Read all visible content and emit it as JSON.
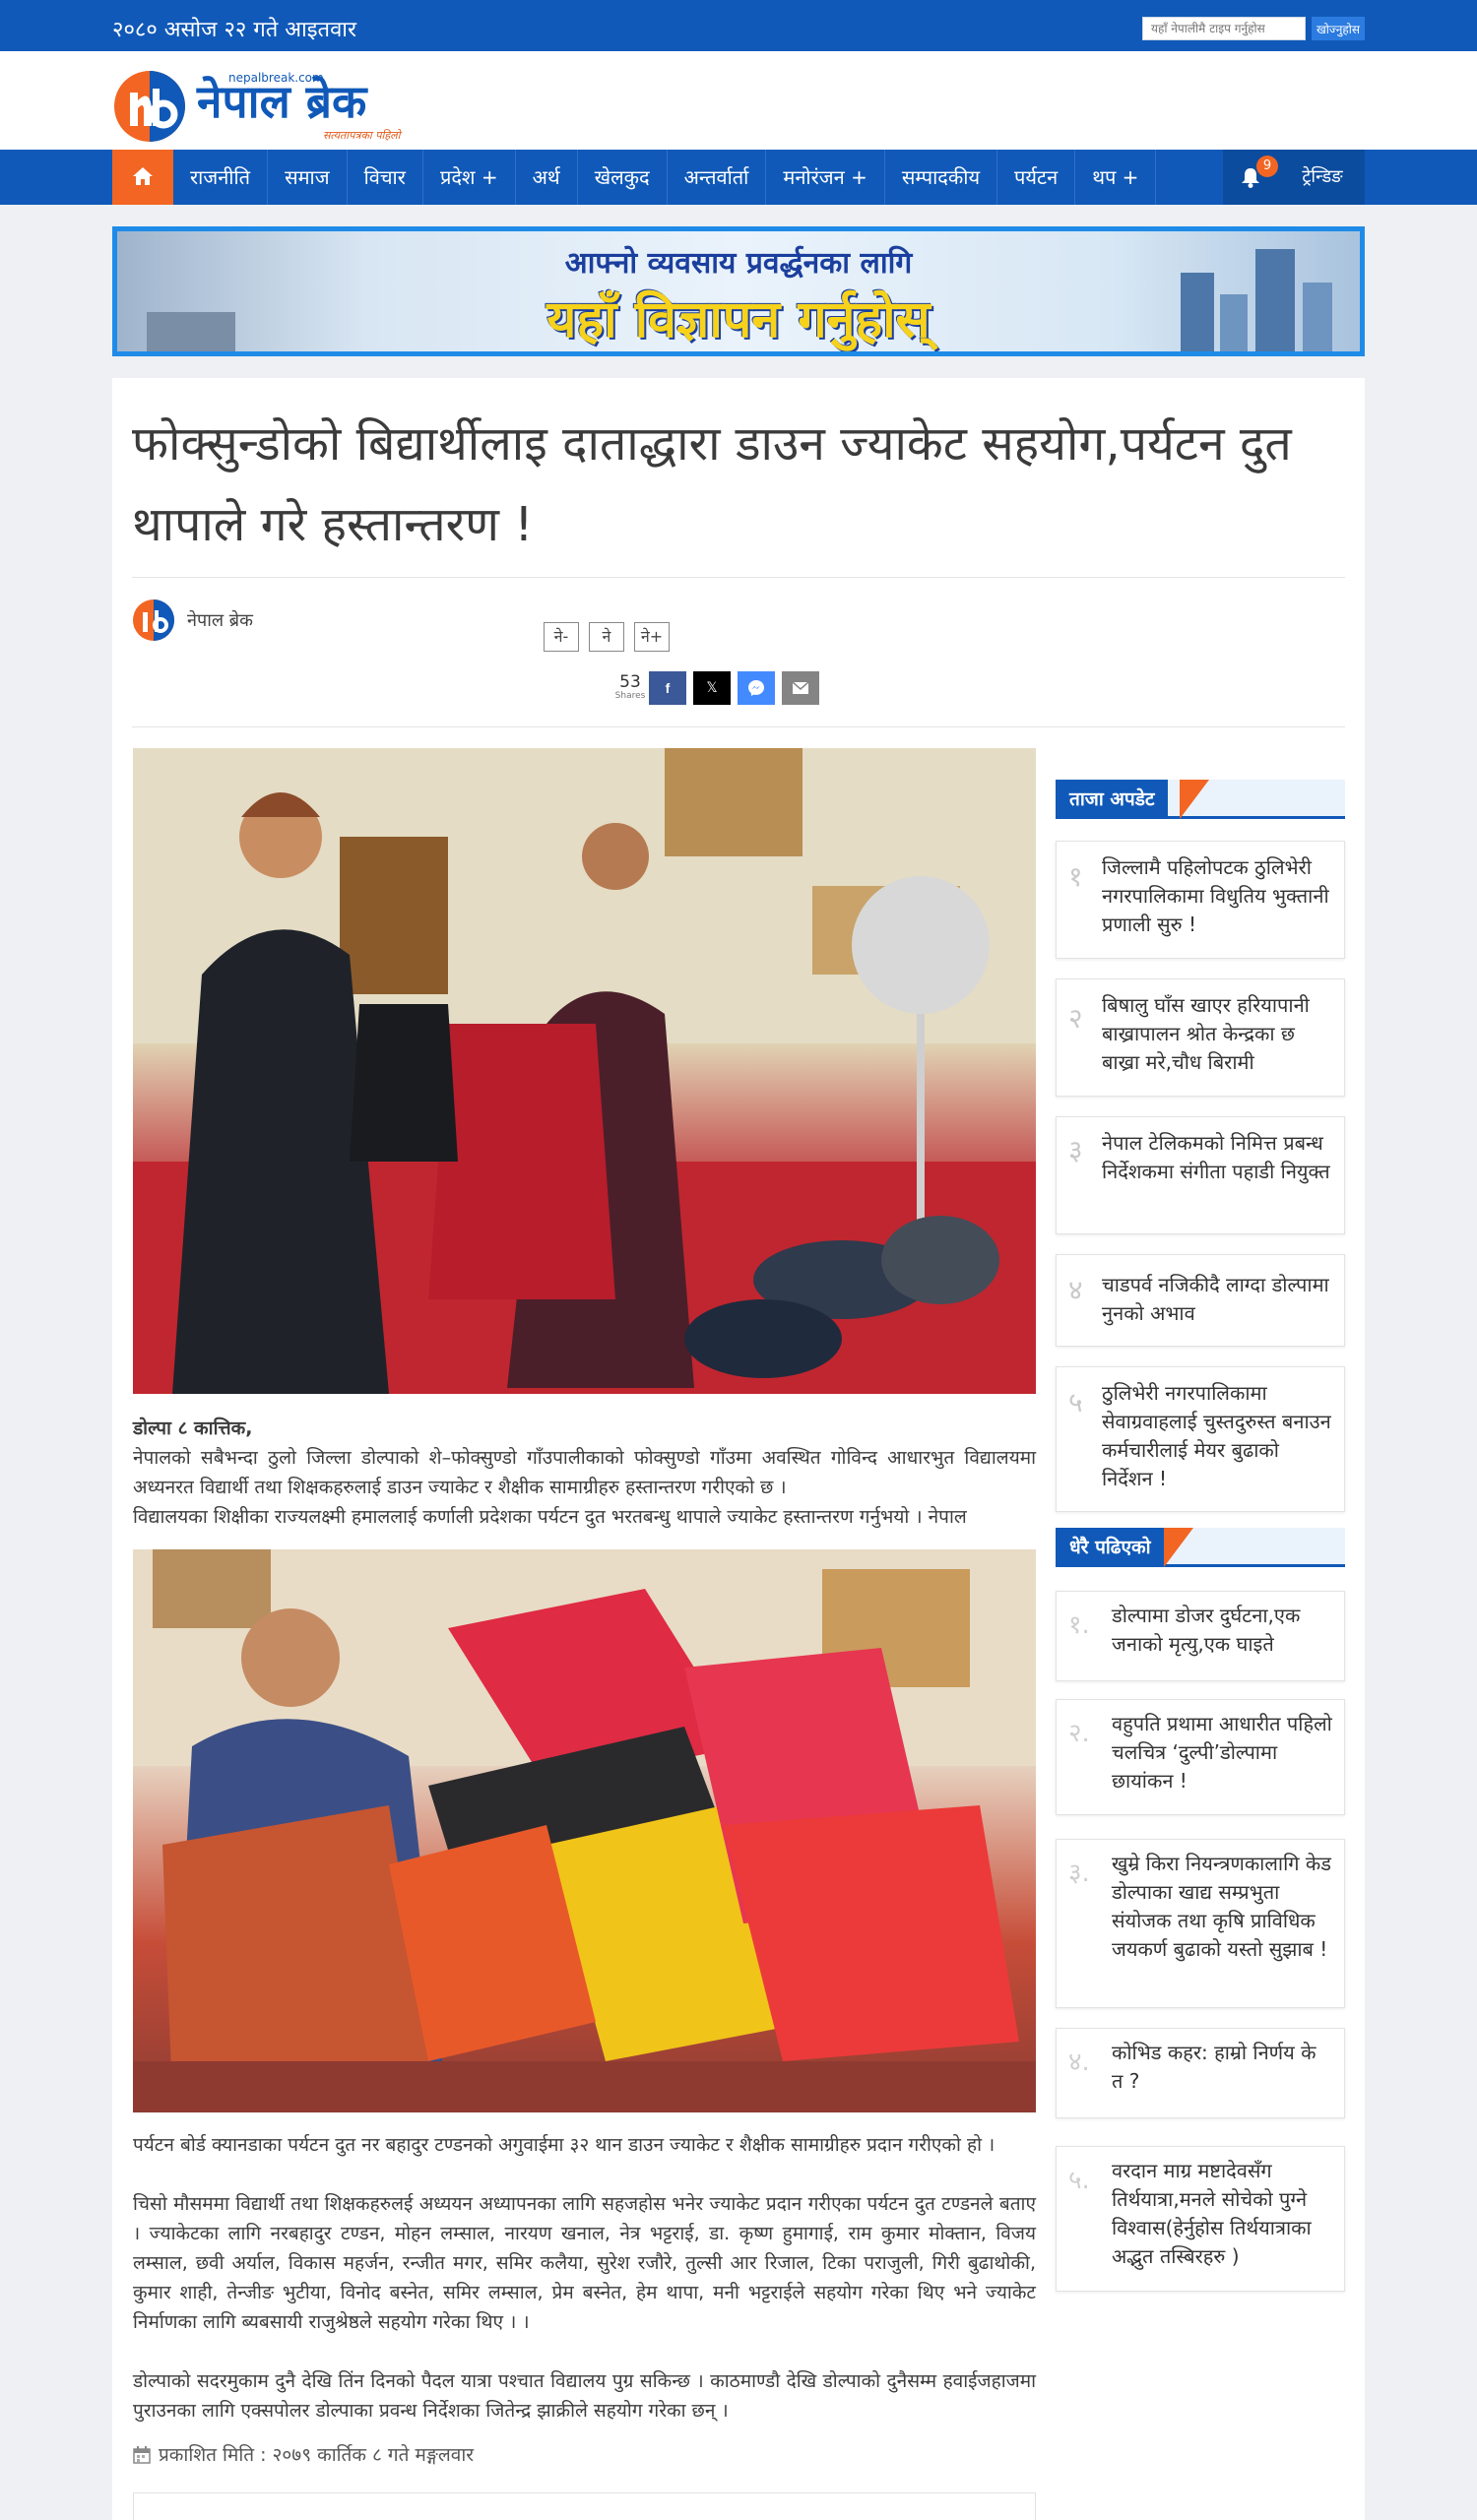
{
  "topbar": {
    "date": "२०८० असोज २२ गते आइतवार",
    "search_placeholder": "यहाँ नेपालीमै टाइप गर्नुहोस",
    "search_button": "खोज्नुहोस"
  },
  "logo": {
    "site": "nepalbreak.com",
    "name": "नेपाल ब्रेक",
    "tagline": "सत्यतापत्रका पहिलो"
  },
  "nav": {
    "items": [
      "राजनीति",
      "समाज",
      "विचार",
      "प्रदेश +",
      "अर्थ",
      "खेलकुद",
      "अन्तर्वार्ता",
      "मनोरंजन +",
      "सम्पादकीय",
      "पर्यटन",
      "थप +"
    ],
    "notification_count": "9",
    "trending": "ट्रेन्डिङ"
  },
  "ad": {
    "line1": "आफ्नो व्यवसाय प्रवर्द्धनका लागि",
    "line2": "यहाँ विज्ञापन गर्नुहोस्"
  },
  "article": {
    "title": "फोक्सुन्डोको बिद्यार्थीलाइ  दाताद्धारा डाउन ज्याकेट सहयोग,पर्यटन दुत थापाले गरे हस्तान्तरण !",
    "author": "नेपाल ब्रेक",
    "font_controls": [
      "ने-",
      "ने",
      "ने+"
    ],
    "share_count": "53",
    "share_label": "Shares",
    "dateline": "डोल्पा ८ कात्तिक,",
    "para1": "नेपालको सबैभन्दा ठुलो जिल्ला डोल्पाको शे–फोक्सुण्डो गाँउपालीकाको फोक्सुण्डो गाँउमा अवस्थित गोविन्द आधारभुत विद्यालयमा अध्यनरत विद्यार्थी तथा शिक्षकहरुलाई डाउन ज्याकेट र शैक्षीक सामाग्रीहरु हस्तान्तरण गरीएको छ ।",
    "para2": "विद्यालयका शिक्षीका राज्यलक्ष्मी हमाललाई कर्णाली प्रदेशका पर्यटन दुत भरतबन्धु थापाले ज्याकेट हस्तान्तरण गर्नुभयो । नेपाल",
    "para3": "पर्यटन बोर्ड क्यानडाका पर्यटन दुत नर बहादुर टण्डनको अगुवाईमा ३२ थान डाउन ज्याकेट र शैक्षीक सामाग्रीहरु प्रदान गरीएको हो ।",
    "para4": "चिसो मौसममा विद्यार्थी तथा शिक्षकहरुलई अध्ययन अध्यापनका लागि सहजहोस भनेर ज्याकेट प्रदान गरीएका पर्यटन दुत टण्डनले बताए । ज्याकेटका लागि नरबहादुर टण्डन, मोहन लम्साल, नारयण खनाल, नेत्र भट्टराई, डा. कृष्ण हुमागाई, राम कुमार मोक्तान, विजय लम्साल, छवी अर्याल, विकास महर्जन, रन्जीत मगर, समिर कलैया, सुरेश रजौरे, तुल्सी आर रिजाल, टिका पराजुली, गिरी बुढाथोकी, कुमार शाही, तेन्जीङ भुटीया, विनोद बस्नेत, समिर लम्साल, प्रेम बस्नेत, हेम थापा, मनी भट्टराईले सहयोग गरेका थिए भने ज्याकेट निर्माणका लागि ब्यबसायी राजुश्रेष्ठले सहयोग गरेका थिए । ।",
    "para5": "डोल्पाको सदरमुकाम दुनै देखि तिंन दिनको पैदल यात्रा पश्चात विद्यालय पुग्र सकिन्छ । काठमाण्डौ देखि डोल्पाको दुनैसम्म हवाईजहाजमा पुराउनका लागि एक्सपोलर डोल्पाका प्रवन्ध निर्देशका जितेन्द्र झाक्रीले सहयोग गरेका छन् ।",
    "published": "प्रकाशित मिति : २०७९ कार्तिक ८ गते मङ्गलवार"
  },
  "sidebar": {
    "latest_title": "ताजा अपडेट",
    "latest": [
      {
        "num": "१",
        "text": "जिल्लामै पहिलोपटक ठुलिभेरी नगरपालिकामा विधुतिय भुक्तानी प्रणाली सुरु !"
      },
      {
        "num": "२",
        "text": "बिषालु घाँस खाएर हरियापानी बाख्रापालन श्रोत केन्द्रका छ बाख्रा मरे,चौध बिरामी"
      },
      {
        "num": "३",
        "text": "नेपाल टेलिकमको निमित्त प्रबन्ध निर्देशकमा संगीता पहाडी नियुक्त"
      },
      {
        "num": "४",
        "text": "चाडपर्व नजिकीदै लाग्दा डोल्पामा नुनको अभाव"
      },
      {
        "num": "५",
        "text": "ठुलिभेरी नगरपालिकामा सेवाग्रवाहलाई चुस्तदुरुस्त बनाउन कर्मचारीलाई मेयर बुढाको निर्देशन !"
      }
    ],
    "popular_title": "धेरै पढिएको",
    "popular": [
      {
        "num": "१.",
        "text": "डोल्पामा डोजर दुर्घटना,एक जनाको मृत्यु,एक घाइते"
      },
      {
        "num": "२.",
        "text": "वहुपति प्रथामा आधारीत पहिलो चलचित्र ‘दुल्पी’डोल्पामा छायांकन !"
      },
      {
        "num": "३.",
        "text": "खुम्रे किरा नियन्त्रणकालागि केड डोल्पाका खाद्य सम्प्रभुता संयोजक तथा कृषि प्राविधिक जयकर्ण बुढाको यस्तो सुझाब !"
      },
      {
        "num": "४.",
        "text": "कोभिड कहर: हाम्रो निर्णय के त ?"
      },
      {
        "num": "५.",
        "text": "वरदान माग्र मष्टादेवसँग तिर्थयात्रा,मनले सोचेको पुग्ने विश्वास(हेर्नुहोस तिर्थयात्राका अद्भुत तस्बिरहरु )"
      }
    ]
  }
}
